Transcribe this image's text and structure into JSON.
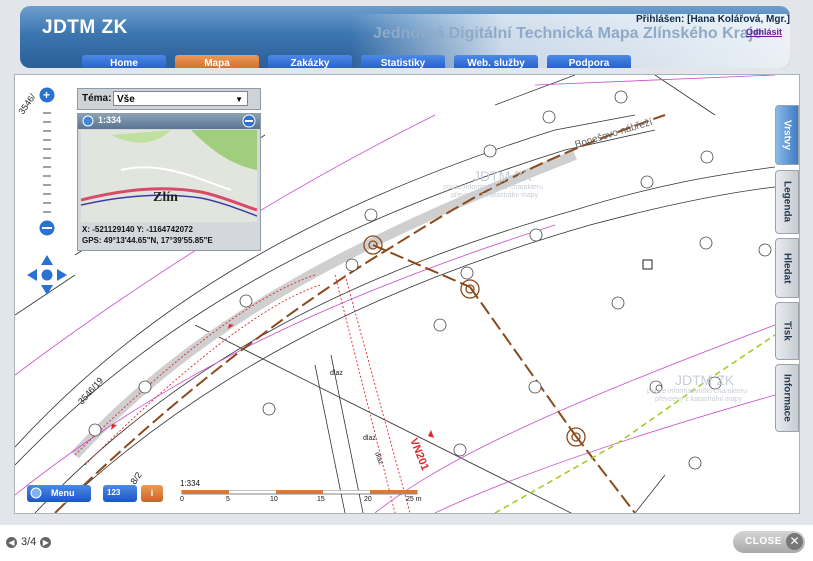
{
  "header": {
    "logo": "JDTM ZK",
    "long_title": "Jednotná Digitální Technická Mapa Zlínského Kraje",
    "login": "Přihlášen: [Hana Kolářová, Mgr.]",
    "logout": "Odhlásit"
  },
  "nav": [
    "Home",
    "Mapa",
    "Zakázky",
    "Statistiky",
    "Web. služby",
    "Podpora"
  ],
  "side_tabs": [
    "Vrstvy",
    "Legenda",
    "Hledat",
    "Tisk",
    "Informace"
  ],
  "tema": {
    "label": "Téma:",
    "value": "Vše"
  },
  "overview": {
    "scale": "1:334",
    "city": "Zlín",
    "coords_xy": "X: -521129140 Y: -1164742072",
    "coords_gps": "GPS: 49°13'44.65\"N, 17°39'55.85\"E"
  },
  "map_labels": {
    "street": "Bonešovo nábřeží",
    "parcel_1": "3546/19",
    "parcel_2": "3546/",
    "parcel_3": "8/2",
    "vn_label": "VN201",
    "dlaz_1": "dlaz",
    "dlaz_2": "dlaz",
    "dlaz_3": "dlaz",
    "watermark_title": "JDTM ZK",
    "watermark_line1": "pouze informativního charakteru",
    "watermark_line2": "převzeny z katastrální mapy"
  },
  "scale_bar": {
    "ratio": "1:334",
    "ticks": [
      "0",
      "5",
      "10",
      "15",
      "20",
      "25 m"
    ]
  },
  "bottom": {
    "menu": "Menu",
    "info": "i",
    "switch": "123"
  },
  "pager": {
    "text": "3/4"
  },
  "close": {
    "label": "CLOSE"
  },
  "colors": {
    "nav_active": "#d9763a",
    "nav": "#2a6cd6",
    "header": "#3c76b0"
  }
}
